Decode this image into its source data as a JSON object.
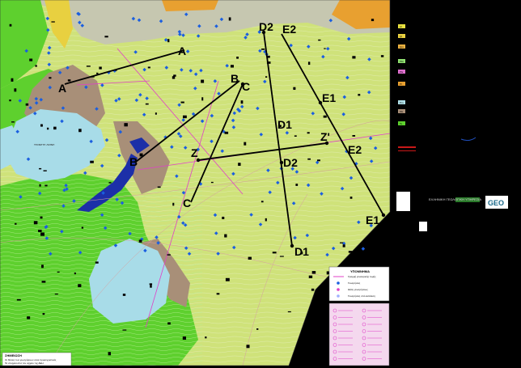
{
  "map": {
    "section_lines": [
      {
        "id": "A",
        "start_label": "A",
        "end_label": "A"
      },
      {
        "id": "B",
        "start_label": "B",
        "end_label": "B"
      },
      {
        "id": "C",
        "start_label": "C",
        "end_label": "C"
      },
      {
        "id": "Z",
        "start_label": "Z",
        "end_label": "Z'"
      },
      {
        "id": "D",
        "start_label": "D2",
        "end_label": "D1"
      },
      {
        "id": "D-mid",
        "start_label": "D1",
        "end_label": "D2"
      },
      {
        "id": "E",
        "start_label": "E2",
        "end_label": "E1"
      },
      {
        "id": "E-mid",
        "start_label": "E1",
        "end_label": "E2"
      }
    ],
    "lake_label": "ΤΕΧΝΗΤΗ ΛΙΜΝΗ",
    "colors": {
      "background": "#000000",
      "yellow_green": "#cfe27a",
      "bright_green": "#5ed02e",
      "light_blue": "#a8dce8",
      "brown": "#a88f78",
      "orange": "#e8a030",
      "dark_blue": "#1c2fa8",
      "point_blue": "#1b5fe0",
      "magenta": "#e040c8"
    }
  },
  "legend": {
    "title": "ΥΠΟΜΝΗΜΑ",
    "items": [
      "Γραμμή γεωλογικής τομής",
      "Γεωτρήσεις",
      "Θέση γεωτρήσεως",
      "Γεωτρήσεις υπό εκτέλεση"
    ]
  },
  "side_legend": {
    "codes": [
      "Al",
      "Ql",
      "Qm",
      "Plm",
      "Pls",
      "Pl",
      "Pm",
      "Ms",
      "Ts"
    ]
  },
  "note": {
    "title": "ΣΗΜΕΙΩΣΗ",
    "lines": [
      "Οι θέσεις των γεωτρήσεων είναι προσεγγιστικές",
      "Τα στοιχεία από τον αρχείο της ΔΕΗ"
    ]
  },
  "logo": {
    "text": "GEO"
  },
  "organization": "ΕΛΛΗΝΙΚΗ ΓΕΩΛΟΓΙΚΗ ΥΠΗΡΕΣΙΑ"
}
